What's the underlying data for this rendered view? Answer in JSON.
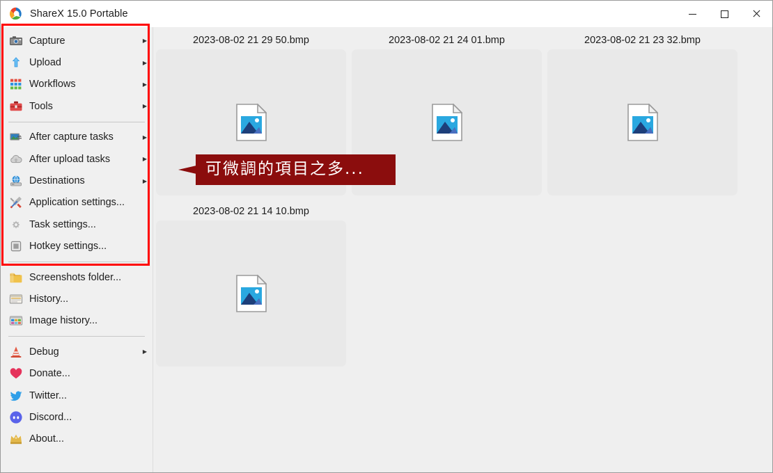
{
  "window": {
    "title": "ShareX 15.0 Portable",
    "app_icon": "sharex-logo-icon",
    "controls": {
      "minimize": "minimize-button",
      "maximize": "maximize-button",
      "close": "close-button"
    }
  },
  "sidebar": {
    "groups": [
      {
        "items": [
          {
            "label": "Capture",
            "icon": "camera-icon",
            "submenu": true
          },
          {
            "label": "Upload",
            "icon": "upload-arrow-icon",
            "submenu": true
          },
          {
            "label": "Workflows",
            "icon": "grid-blocks-icon",
            "submenu": true
          },
          {
            "label": "Tools",
            "icon": "toolbox-icon",
            "submenu": true
          }
        ]
      },
      {
        "items": [
          {
            "label": "After capture tasks",
            "icon": "image-tasks-icon",
            "submenu": true
          },
          {
            "label": "After upload tasks",
            "icon": "cloud-upload-icon",
            "submenu": true
          },
          {
            "label": "Destinations",
            "icon": "globe-disk-icon",
            "submenu": true
          },
          {
            "label": "Application settings...",
            "icon": "wrench-screwdriver-icon",
            "submenu": false
          },
          {
            "label": "Task settings...",
            "icon": "gear-icon",
            "submenu": false
          },
          {
            "label": "Hotkey settings...",
            "icon": "keyboard-key-icon",
            "submenu": false
          }
        ]
      },
      {
        "items": [
          {
            "label": "Screenshots folder...",
            "icon": "folder-icon",
            "submenu": false
          },
          {
            "label": "History...",
            "icon": "history-window-icon",
            "submenu": false
          },
          {
            "label": "Image history...",
            "icon": "image-grid-icon",
            "submenu": false
          }
        ]
      },
      {
        "items": [
          {
            "label": "Debug",
            "icon": "traffic-cone-icon",
            "submenu": true
          },
          {
            "label": "Donate...",
            "icon": "heart-icon",
            "submenu": false
          },
          {
            "label": "Twitter...",
            "icon": "twitter-bird-icon",
            "submenu": false
          },
          {
            "label": "Discord...",
            "icon": "discord-icon",
            "submenu": false
          },
          {
            "label": "About...",
            "icon": "crown-icon",
            "submenu": false
          }
        ]
      }
    ]
  },
  "main": {
    "thumbnails": [
      {
        "name": "2023-08-02 21 29 50.bmp",
        "icon": "image-file-icon"
      },
      {
        "name": "2023-08-02 21 24 01.bmp",
        "icon": "image-file-icon"
      },
      {
        "name": "2023-08-02 21 23 32.bmp",
        "icon": "image-file-icon"
      },
      {
        "name": "2023-08-02 21 14 10.bmp",
        "icon": "image-file-icon"
      }
    ]
  },
  "annotations": {
    "callout_text": "可微調的項目之多...",
    "callout_color": "#8b0d0d",
    "highlight_box_color": "#ff0000"
  }
}
